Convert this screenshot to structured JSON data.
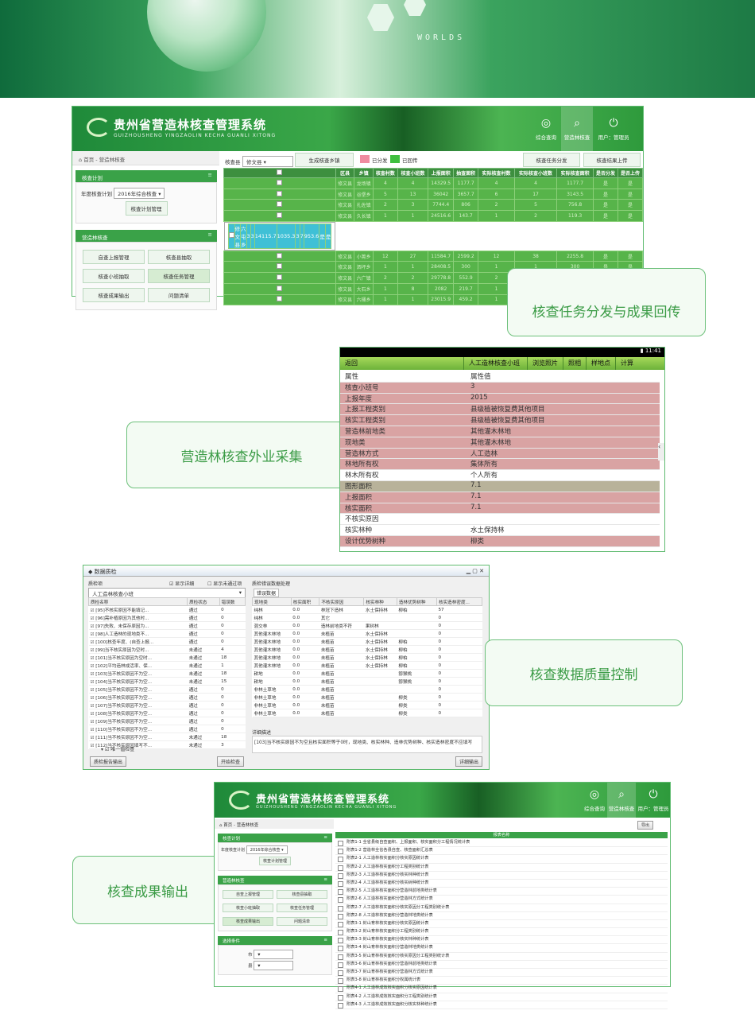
{
  "colors": {
    "brand_green": "#3aa248",
    "grid_green": "#57b44a",
    "selected_row": "#3fc0d6",
    "sent_swatch": "#f08ca0",
    "received_swatch": "#3fbf3f",
    "mobile_red": "#d9a3a3"
  },
  "banner": {
    "word": "WORLDS"
  },
  "app": {
    "title": "贵州省营造林核查管理系统",
    "subtitle": "GUIZHOUSHENG YINGZAOLIN KECHA GUANLI XITONG",
    "nav": [
      {
        "label": "综合查询",
        "icon": "globe-icon"
      },
      {
        "label": "营造林核查",
        "icon": "search-icon"
      },
      {
        "label": "用户：管理员",
        "icon": "user-power-icon"
      }
    ]
  },
  "panel1": {
    "breadcrumb": "首页 - 营造林核查",
    "plan_header": "核查计划",
    "plan_label": "年度核查计划",
    "plan_value": "2016年综合核查",
    "plan_button": "核查计划管理",
    "forest_header": "营造林核查",
    "side_buttons": [
      "自查上报管理",
      "核查县抽取",
      "核查小班抽取",
      "核查任务管理",
      "核查成果输出",
      "问题清单"
    ],
    "county_label": "核查县",
    "county_value": "修文县",
    "gen_button": "生成核查乡镇",
    "legend_sent": "已分发",
    "legend_received": "已回传",
    "task_button": "核查任务分发",
    "upload_button": "核查结果上传",
    "columns": [
      "区县",
      "乡镇",
      "核查村数",
      "核查小班数",
      "上报面积",
      "抽查面积",
      "实际核查村数",
      "实际核查小班数",
      "实际核查面积",
      "是否分发",
      "是否上传"
    ],
    "rows": [
      [
        "修文县",
        "龙场镇",
        "4",
        "4",
        "14329.5",
        "1177.7",
        "4",
        "4",
        "1177.7",
        "是",
        "是"
      ],
      [
        "修文县",
        "谷堡乡",
        "5",
        "13",
        "36042",
        "3657.7",
        "6",
        "17",
        "3143.5",
        "是",
        "是"
      ],
      [
        "修文县",
        "扎佐镇",
        "2",
        "3",
        "7744.4",
        "806",
        "2",
        "5",
        "756.8",
        "是",
        "是"
      ],
      [
        "修文县",
        "久长镇",
        "1",
        "1",
        "24516.6",
        "143.7",
        "1",
        "2",
        "119.3",
        "是",
        "是"
      ],
      [
        "修文县",
        "六屯乡",
        "3",
        "3",
        "14115.7",
        "1035.3",
        "3",
        "7",
        "953.6",
        "是",
        "是"
      ],
      [
        "修文县",
        "小箐乡",
        "12",
        "27",
        "11584.7",
        "2599.2",
        "12",
        "38",
        "2255.8",
        "是",
        "是"
      ],
      [
        "修文县",
        "洒坪乡",
        "1",
        "1",
        "28408.5",
        "300",
        "1",
        "1",
        "300",
        "是",
        "是"
      ],
      [
        "修文县",
        "六广镇",
        "2",
        "2",
        "29778.8",
        "552.9",
        "2",
        "3",
        "322.9",
        "是",
        "是"
      ],
      [
        "修文县",
        "大石乡",
        "1",
        "8",
        "2082",
        "219.7",
        "1",
        "8",
        "135.7",
        "是",
        "是"
      ],
      [
        "修文县",
        "六桶乡",
        "1",
        "1",
        "23015.9",
        "459.2",
        "1",
        "1",
        "459.2",
        "是",
        "是"
      ]
    ],
    "selected_row": 4,
    "caption": "核查任务分发与成果回传"
  },
  "panel2": {
    "status_time": "11:41",
    "back": "返回",
    "title": "人工造林核查小班",
    "tabs": [
      "浏览照片",
      "照相",
      "样地点",
      "计算"
    ],
    "head_key": "属性",
    "head_val": "属性值",
    "rows": [
      {
        "k": "核查小班号",
        "v": "3",
        "style": "red"
      },
      {
        "k": "上报年度",
        "v": "2015",
        "style": "red"
      },
      {
        "k": "上报工程类别",
        "v": "县级植被恢复费其他项目",
        "style": "red"
      },
      {
        "k": "核实工程类别",
        "v": "县级植被恢复费其他项目",
        "style": "red"
      },
      {
        "k": "营造林前地类",
        "v": "其他灌木林地",
        "style": "red"
      },
      {
        "k": "现地类",
        "v": "其他灌木林地",
        "style": "red"
      },
      {
        "k": "营造林方式",
        "v": "人工造林",
        "style": "red"
      },
      {
        "k": "林地所有权",
        "v": "集体所有",
        "style": "red"
      },
      {
        "k": "林木所有权",
        "v": "个人所有",
        "style": "plain"
      },
      {
        "k": "图形面积",
        "v": "7.1",
        "style": "tan"
      },
      {
        "k": "上报面积",
        "v": "7.1",
        "style": "red"
      },
      {
        "k": "核实面积",
        "v": "7.1",
        "style": "red"
      },
      {
        "k": "不核实原因",
        "v": "",
        "style": "plain"
      },
      {
        "k": "核实林种",
        "v": "水土保持林",
        "style": "plain"
      },
      {
        "k": "设计优势树种",
        "v": "柳类",
        "style": "red"
      }
    ],
    "caption": "营造林核查外业采集"
  },
  "panel3": {
    "title": "数据质检",
    "item_label": "质检项",
    "show_detail": "显示详细",
    "show_failed": "显示未通过项",
    "selector": "人工造林核查小班",
    "cols": [
      "质检名称",
      "质检状态",
      "错误数"
    ],
    "checks": [
      [
        "[95]不核实原因不能填记...",
        "通过",
        "0"
      ],
      [
        "[96]需补植原因为其他时...",
        "通过",
        "0"
      ],
      [
        "[97]失败、未保存原因为...",
        "通过",
        "0"
      ],
      [
        "[98]人工造林的现地类不...",
        "通过",
        "0"
      ],
      [
        "[100]核查年度、(自查上报...",
        "通过",
        "0"
      ],
      [
        "[99]当不核实原因为空时...",
        "未通过",
        "4"
      ],
      [
        "[101]当不核实原因为空时...",
        "未通过",
        "18"
      ],
      [
        "[102]平均造林成活率、保...",
        "未通过",
        "1"
      ],
      [
        "[103]当不核实原因不为空...",
        "未通过",
        "18"
      ],
      [
        "[104]当不核实原因不为空...",
        "未通过",
        "15"
      ],
      [
        "[105]当不核实原因不为空...",
        "通过",
        "0"
      ],
      [
        "[106]当不核实原因不为空...",
        "通过",
        "0"
      ],
      [
        "[107]当不核实原因不为空...",
        "通过",
        "0"
      ],
      [
        "[108]当不核实原因不为空...",
        "通过",
        "0"
      ],
      [
        "[109]当不核实原因不为空...",
        "通过",
        "0"
      ],
      [
        "[110]当不核实原因不为空...",
        "通过",
        "0"
      ],
      [
        "[111]当不核实原因不为空...",
        "未通过",
        "18"
      ],
      [
        "[112]当不核实原因填写不...",
        "未通过",
        "3"
      ]
    ],
    "group_label": "唯一值检查",
    "report_button": "质检报告输出",
    "start_button": "开始检查",
    "right_title": "质检错误数据处理",
    "right_tab": "错误数据",
    "ecols": [
      "现地类",
      "核实面积",
      "不核实原因",
      "核实林种",
      "造林优势树种",
      "核实造林密度..."
    ],
    "erows": [
      [
        "纯林",
        "0.0",
        "林冠下造林",
        "水土保持林",
        "柳柏",
        "57"
      ],
      [
        "纯林",
        "0.0",
        "其它",
        "",
        "",
        "0"
      ],
      [
        "混交林",
        "0.0",
        "造林前地类不符",
        "果树林",
        "",
        "0"
      ],
      [
        "其他灌木林地",
        "0.0",
        "未植苗",
        "水土保持林",
        "",
        "0"
      ],
      [
        "其他灌木林地",
        "0.0",
        "未植苗",
        "水土保持林",
        "柳柏",
        "0"
      ],
      [
        "其他灌木林地",
        "0.0",
        "未植苗",
        "水土保持林",
        "柳柏",
        "0"
      ],
      [
        "其他灌木林地",
        "0.0",
        "未植苗",
        "水土保持林",
        "柳柏",
        "0"
      ],
      [
        "其他灌木林地",
        "0.0",
        "未植苗",
        "水土保持林",
        "柳柏",
        "0"
      ],
      [
        "耕地",
        "0.0",
        "未植苗",
        "",
        "猕猴桃",
        "0"
      ],
      [
        "耕地",
        "0.0",
        "未植苗",
        "",
        "猕猴桃",
        "0"
      ],
      [
        "非林土草地",
        "0.0",
        "未植苗",
        "",
        "",
        "0"
      ],
      [
        "非林土草地",
        "0.0",
        "未植苗",
        "",
        "柳类",
        "0"
      ],
      [
        "非林土草地",
        "0.0",
        "未植苗",
        "",
        "柳类",
        "0"
      ],
      [
        "非林土草地",
        "0.0",
        "未植苗",
        "",
        "柳类",
        "0"
      ]
    ],
    "detail_title": "详细描述",
    "detail_text": "[103]当不核实原因不为空且核实面积等于0时，现地类、核实林种、造林优势树种、核实造林密度不应填写",
    "detail_button": "详细输出",
    "caption": "核查数据质量控制"
  },
  "panel4": {
    "title": "贵州省营造林核查管理系统",
    "subtitle": "GUIZHOUSHENG YINGZAOLIN KECHA GUANLI XITONG",
    "breadcrumb": "首页 - 营造林核查",
    "plan_header": "核查计划",
    "plan_label": "年度核查计划",
    "plan_value": "2016年综合核查",
    "plan_button": "核查计划管理",
    "forest_header": "营造林核查",
    "side_buttons": [
      "自查上报管理",
      "核查县抽取",
      "核查小班抽取",
      "核查任务管理",
      "核查成果输出",
      "问题清单"
    ],
    "filter_header": "选择条件",
    "filter_labels": [
      "市",
      "县"
    ],
    "export_button": "导出",
    "list_header": "报表名称",
    "reports": [
      "附表1-1 全省县级自查面积、上报面积、核实面积分工程情况统计表",
      "附表1-2 营造林全省各县自查、核查面积汇总表",
      "附表2-1 人工造林核实面积分核实原因统计表",
      "附表2-2 人工造林核实面积分工程类别统计表",
      "附表2-3 人工造林核实面积分核实林种统计表",
      "附表2-4 人工造林核实面积分核实树种统计表",
      "附表2-5 人工造林核实面积分营造林前地类统计表",
      "附表2-6 人工造林核实面积分营造林方式统计表",
      "附表2-7 人工造林核实面积分核实原因分工程类别统计表",
      "附表2-8 人工造林核实面积分营造林地类统计表",
      "附表3-1 封山育林核实面积分核实原因统计表",
      "附表3-2 封山育林核实面积分工程类别统计表",
      "附表3-3 封山育林核实面积分核实林种统计表",
      "附表3-4 封山育林核实面积分营造林地类统计表",
      "附表3-5 封山育林核实面积分核实原因分工程类别统计表",
      "附表3-6 封山育林核实面积分营造林前地类统计表",
      "附表3-7 封山育林核实面积分营造林方式统计表",
      "附表3-8 封山育林核实面积分权属统计表",
      "附表4-1 人工造林成效核实面积分核实原因统计表",
      "附表4-2 人工造林成效核实面积分工程类别统计表",
      "附表4-3 人工造林成效核实面积分核实林种统计表"
    ],
    "caption": "核查成果输出"
  }
}
